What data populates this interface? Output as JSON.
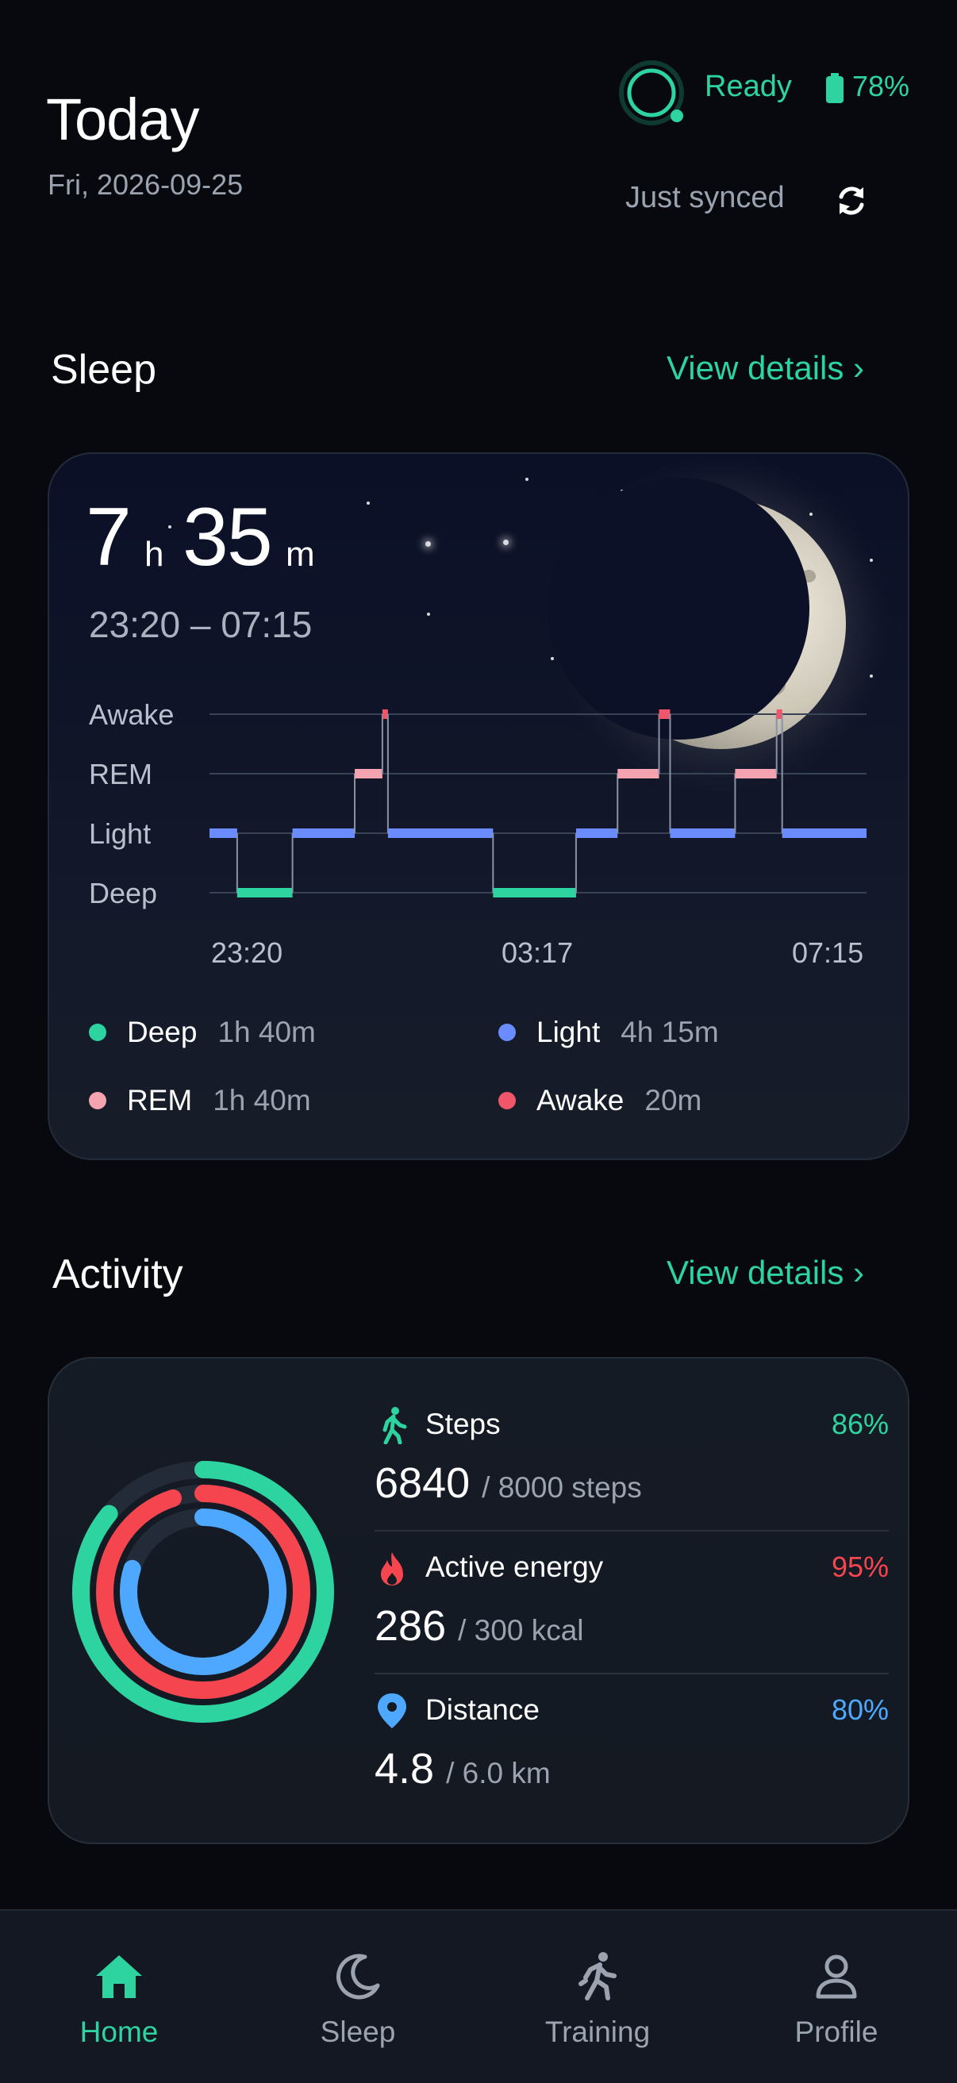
{
  "header": {
    "title": "Today",
    "date": "Fri, 2026-09-25",
    "device_status": "Ready",
    "battery": "78%",
    "sync_status": "Just synced"
  },
  "sleep": {
    "section_title": "Sleep",
    "view_details": "View details ›",
    "duration_hours": "7",
    "hours_unit": "h",
    "duration_minutes": "35",
    "minutes_unit": "m",
    "time_range": "23:20 – 07:15",
    "stage_labels": [
      "Awake",
      "REM",
      "Light",
      "Deep"
    ],
    "time_axis": [
      "23:20",
      "03:17",
      "07:15"
    ],
    "hypnogram": [
      {
        "stage": "Light",
        "start": "23:20",
        "end": "23:40"
      },
      {
        "stage": "Deep",
        "start": "23:40",
        "end": "00:20"
      },
      {
        "stage": "Light",
        "start": "00:20",
        "end": "01:05"
      },
      {
        "stage": "REM",
        "start": "01:05",
        "end": "01:25"
      },
      {
        "stage": "Awake",
        "start": "01:25",
        "end": "01:29"
      },
      {
        "stage": "Light",
        "start": "01:29",
        "end": "02:45"
      },
      {
        "stage": "Deep",
        "start": "02:45",
        "end": "03:45"
      },
      {
        "stage": "Light",
        "start": "03:45",
        "end": "04:15"
      },
      {
        "stage": "REM",
        "start": "04:15",
        "end": "04:45"
      },
      {
        "stage": "Awake",
        "start": "04:45",
        "end": "04:53"
      },
      {
        "stage": "Light",
        "start": "04:53",
        "end": "05:40"
      },
      {
        "stage": "REM",
        "start": "05:40",
        "end": "06:10"
      },
      {
        "stage": "Awake",
        "start": "06:10",
        "end": "06:14"
      },
      {
        "stage": "Light",
        "start": "06:14",
        "end": "07:15"
      }
    ],
    "legend": [
      {
        "name": "Deep",
        "value": "1h 40m",
        "color": "#2dd4a0"
      },
      {
        "name": "Light",
        "value": "4h 15m",
        "color": "#6b8cff"
      },
      {
        "name": "REM",
        "value": "1h 40m",
        "color": "#f4a3b0"
      },
      {
        "name": "Awake",
        "value": "20m",
        "color": "#f0566a"
      }
    ]
  },
  "activity": {
    "section_title": "Activity",
    "view_details": "View details ›",
    "metrics": [
      {
        "name": "Steps",
        "value": "6840",
        "goal": "/ 8000 steps",
        "percent": "86%",
        "progress": 0.86,
        "color": "#2dd4a0",
        "icon": "walking-icon"
      },
      {
        "name": "Active energy",
        "value": "286",
        "goal": "/ 300 kcal",
        "percent": "95%",
        "progress": 0.95,
        "color": "#f5464f",
        "icon": "flame-icon"
      },
      {
        "name": "Distance",
        "value": "4.8",
        "goal": "/ 6.0 km",
        "percent": "80%",
        "progress": 0.8,
        "color": "#4ea8ff",
        "icon": "location-pin-icon"
      }
    ]
  },
  "nav": {
    "items": [
      {
        "label": "Home",
        "icon": "home-icon",
        "active": true
      },
      {
        "label": "Sleep",
        "icon": "moon-icon",
        "active": false
      },
      {
        "label": "Training",
        "icon": "running-icon",
        "active": false
      },
      {
        "label": "Profile",
        "icon": "person-icon",
        "active": false
      }
    ],
    "active_color": "#2dd4a0",
    "inactive_color": "#9aa3af"
  }
}
